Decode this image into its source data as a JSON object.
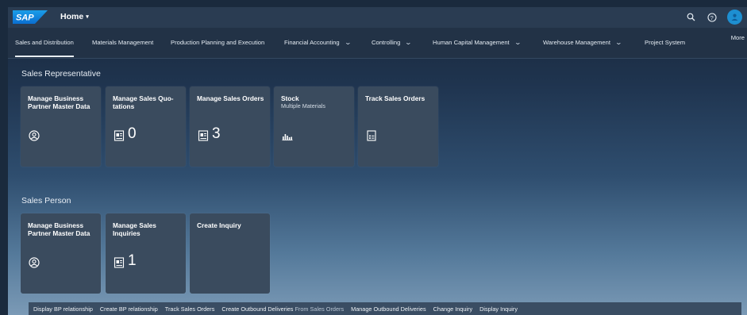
{
  "shell": {
    "logo_text": "SAP",
    "home_label": "Home",
    "home_caret": "▾",
    "avatar_initial": ""
  },
  "tabs": [
    {
      "label": "Sales and Distribution",
      "active": true,
      "has_chevron": false
    },
    {
      "label": "Materials Management",
      "active": false,
      "has_chevron": false
    },
    {
      "label": "Production Planning and Execution",
      "active": false,
      "has_chevron": false
    },
    {
      "label": "Financial Accounting",
      "active": false,
      "has_chevron": true
    },
    {
      "label": "Controlling",
      "active": false,
      "has_chevron": true
    },
    {
      "label": "Human Capital Management",
      "active": false,
      "has_chevron": true
    },
    {
      "label": "Warehouse Management",
      "active": false,
      "has_chevron": true
    },
    {
      "label": "Project System",
      "active": false,
      "has_chevron": false
    }
  ],
  "more_label": "More",
  "sections": [
    {
      "title": "Sales Representative",
      "tiles": [
        {
          "title": "Manage Business Partner Master Data",
          "subtitle": "",
          "icon": "person-circle-icon",
          "number": ""
        },
        {
          "title": "Manage Sales Quo-tations",
          "subtitle": "",
          "icon": "document-icon",
          "number": "0"
        },
        {
          "title": "Manage Sales Orders",
          "subtitle": "",
          "icon": "document-icon",
          "number": "3"
        },
        {
          "title": "Stock",
          "subtitle": "Multiple Materials",
          "icon": "bar-chart-icon",
          "number": ""
        },
        {
          "title": "Track Sales Orders",
          "subtitle": "",
          "icon": "form-icon",
          "number": ""
        }
      ]
    },
    {
      "title": "Sales Person",
      "tiles": [
        {
          "title": "Manage Business Partner Master Data",
          "subtitle": "",
          "icon": "person-circle-icon",
          "number": ""
        },
        {
          "title": "Manage Sales Inquiries",
          "subtitle": "",
          "icon": "document-icon",
          "number": "1"
        },
        {
          "title": "Create Inquiry",
          "subtitle": "",
          "icon": "",
          "number": ""
        }
      ]
    }
  ],
  "links": [
    {
      "label": "Display BP relationship",
      "sub": ""
    },
    {
      "label": "Create BP relationship",
      "sub": ""
    },
    {
      "label": "Track Sales Orders",
      "sub": ""
    },
    {
      "label": "Create Outbound Deliveries",
      "sub": "From Sales Orders"
    },
    {
      "label": "Manage Outbound Deliveries",
      "sub": ""
    },
    {
      "label": "Change Inquiry",
      "sub": ""
    },
    {
      "label": "Display Inquiry",
      "sub": ""
    }
  ],
  "colors": {
    "shell_bg": "#2a3c52",
    "tile_bg": "#3a4b5e",
    "accent": "#1d8fd1",
    "logo_blue": "#0a6ed1"
  }
}
